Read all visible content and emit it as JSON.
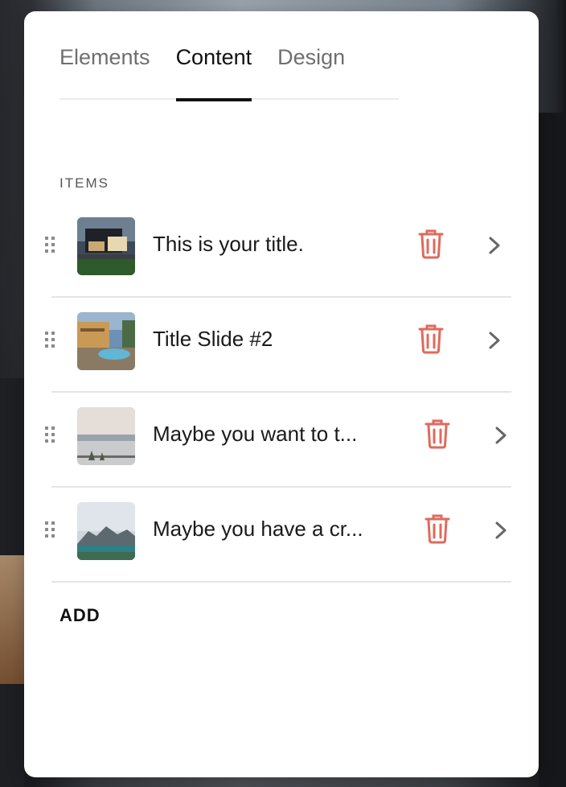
{
  "tabs": [
    {
      "label": "Elements",
      "active": false
    },
    {
      "label": "Content",
      "active": true
    },
    {
      "label": "Design",
      "active": false
    }
  ],
  "items_section": {
    "label": "ITEMS",
    "items": [
      {
        "title": "This is your title.",
        "thumb": "modern-house-at-dusk"
      },
      {
        "title": "Title Slide #2",
        "thumb": "villa-with-pool"
      },
      {
        "title": "Maybe you want to t...",
        "thumb": "misty-lake-horizon"
      },
      {
        "title": "Maybe you have a cr...",
        "thumb": "mountain-lake"
      }
    ]
  },
  "add_label": "ADD",
  "colors": {
    "trash": "#e06a5c",
    "active_tab": "#111111",
    "inactive_tab": "#6f6f6f"
  },
  "icons": {
    "drag": "drag-handle-icon",
    "delete": "trash-icon",
    "open": "chevron-right-icon"
  }
}
